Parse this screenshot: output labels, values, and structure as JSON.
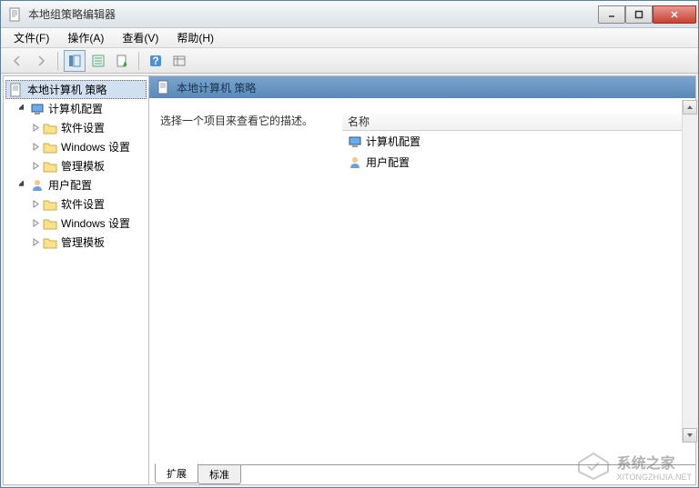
{
  "window": {
    "title": "本地组策略编辑器"
  },
  "menu": {
    "file": "文件(F)",
    "action": "操作(A)",
    "view": "查看(V)",
    "help": "帮助(H)"
  },
  "tree": {
    "root": "本地计算机 策略",
    "computer": {
      "label": "计算机配置",
      "software": "软件设置",
      "windows": "Windows 设置",
      "templates": "管理模板"
    },
    "user": {
      "label": "用户配置",
      "software": "软件设置",
      "windows": "Windows 设置",
      "templates": "管理模板"
    }
  },
  "detail": {
    "header": "本地计算机 策略",
    "description": "选择一个项目来查看它的描述。",
    "column_name": "名称",
    "items": {
      "computer": "计算机配置",
      "user": "用户配置"
    }
  },
  "tabs": {
    "extended": "扩展",
    "standard": "标准"
  },
  "watermark": {
    "main": "系统之家",
    "sub": "XITONGZHIJIA.NET"
  }
}
